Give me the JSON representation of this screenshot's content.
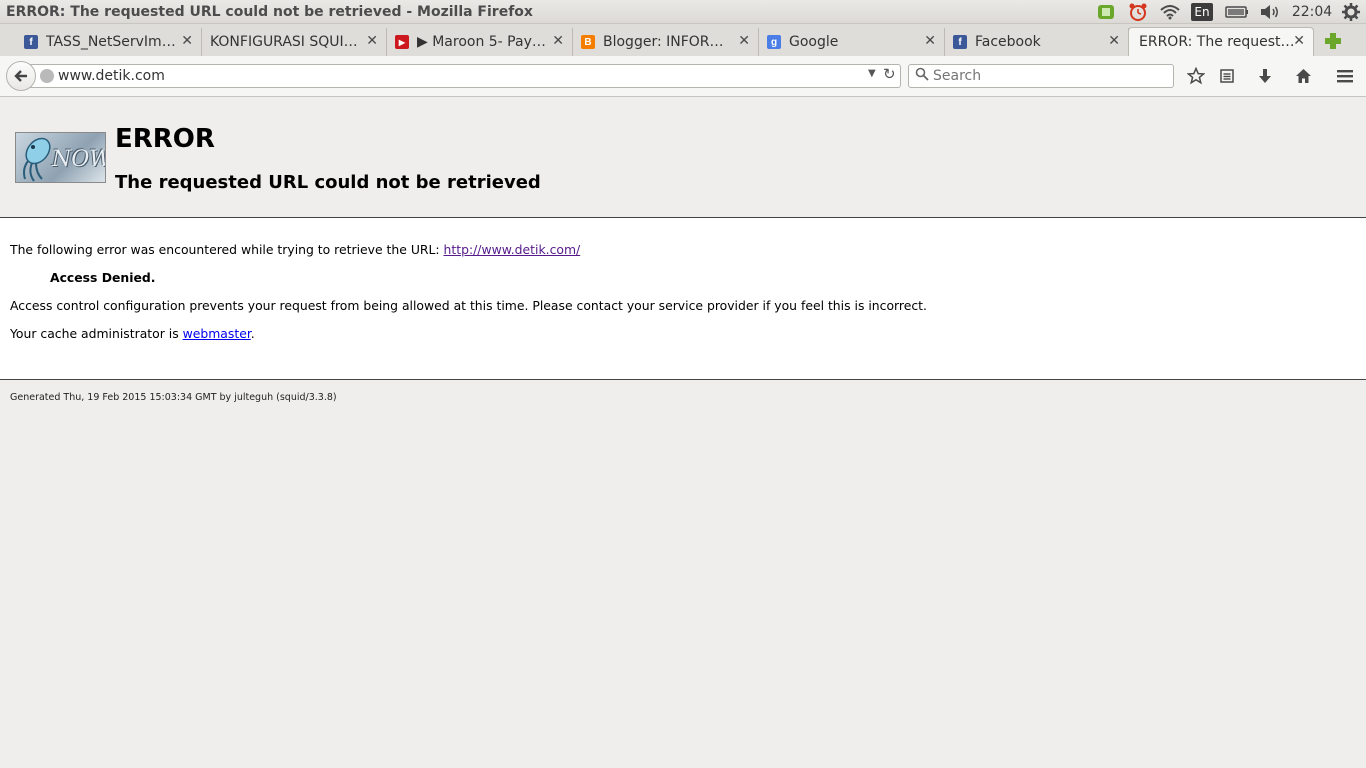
{
  "window": {
    "title": "ERROR: The requested URL could not be retrieved - Mozilla Firefox"
  },
  "tray": {
    "language": "En",
    "clock": "22:04",
    "icons": [
      "updater-icon",
      "alarm-clock-icon",
      "wifi-icon",
      "keyboard-language-icon",
      "battery-icon",
      "volume-icon",
      "settings-gear-icon"
    ]
  },
  "tabs": [
    {
      "label": "TASS_NetServIm…",
      "favicon": "facebook-icon",
      "active": false
    },
    {
      "label": "KONFIGURASI SQUI…",
      "favicon": "",
      "active": false
    },
    {
      "label": "▶ Maroon 5- Pay…",
      "favicon": "youtube-icon",
      "active": false
    },
    {
      "label": "Blogger: INFOR…",
      "favicon": "blogger-icon",
      "active": false
    },
    {
      "label": "Google",
      "favicon": "google-icon",
      "active": false
    },
    {
      "label": "Facebook",
      "favicon": "facebook-icon",
      "active": false
    },
    {
      "label": "ERROR: The request…",
      "favicon": "",
      "active": true
    }
  ],
  "navbar": {
    "url": "www.detik.com",
    "search_placeholder": "Search"
  },
  "page": {
    "logo_text": "NOW",
    "title": "ERROR",
    "subtitle": "The requested URL could not be retrieved",
    "line1_prefix": "The following error was encountered while trying to retrieve the URL: ",
    "line1_link": "http://www.detik.com/",
    "access_denied": "Access Denied.",
    "line3": "Access control configuration prevents your request from being allowed at this time. Please contact your service provider if you feel this is incorrect.",
    "line4_prefix": "Your cache administrator is ",
    "line4_link": "webmaster",
    "line4_suffix": ".",
    "footer": "Generated Thu, 19 Feb 2015 15:03:34 GMT by julteguh (squid/3.3.8)"
  },
  "colors": {
    "facebook": "#3b5998",
    "youtube": "#cc181e",
    "blogger": "#f57d00",
    "google": "#4a7ee6",
    "visited_link": "#551a8b",
    "link": "#0000ee",
    "new_tab_plus": "#6aa72a"
  }
}
